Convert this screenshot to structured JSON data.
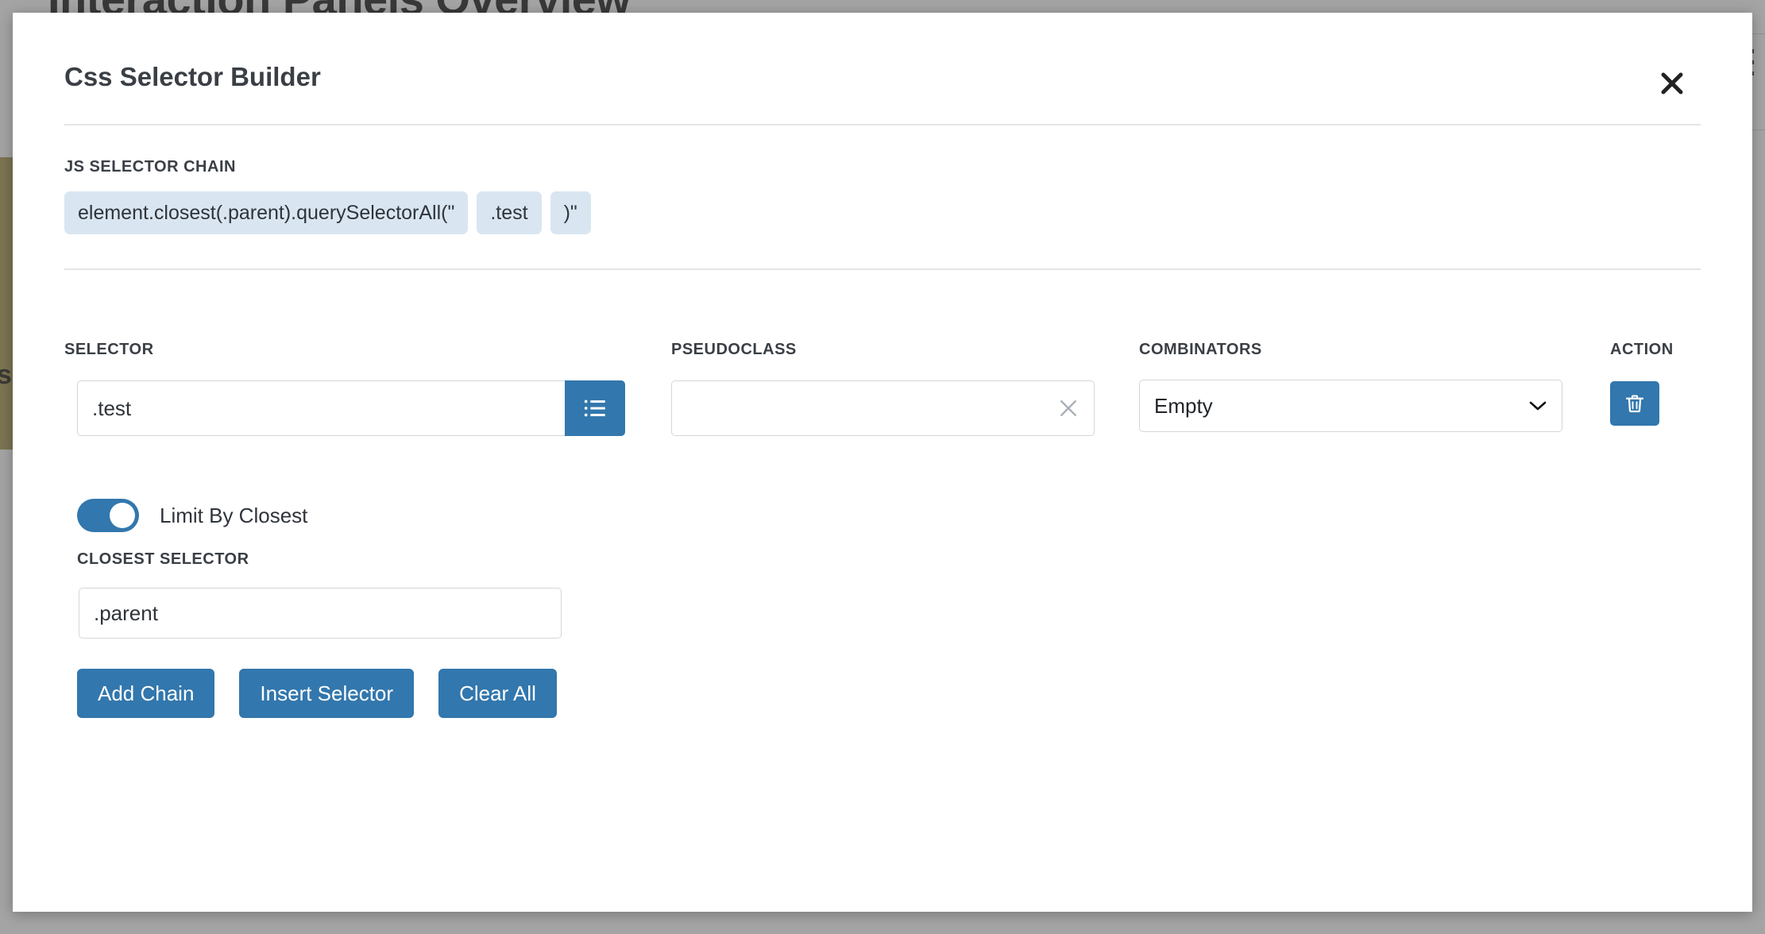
{
  "background": {
    "page_title": "Interaction Panels Overview",
    "side_panel_text": "ss",
    "menu_icon": "hamburger-icon"
  },
  "modal": {
    "title": "Css Selector Builder",
    "close_icon": "close-icon",
    "chain": {
      "label": "JS SELECTOR CHAIN",
      "chips": [
        "element.closest(.parent).querySelectorAll(\"",
        ".test",
        ")\""
      ]
    },
    "columns": {
      "selector": "SELECTOR",
      "pseudoclass": "PSEUDOCLASS",
      "combinators": "COMBINATORS",
      "action": "ACTION"
    },
    "row": {
      "selector_value": ".test",
      "selector_placeholder": "",
      "selector_list_icon": "list-icon",
      "pseudoclass_value": "",
      "pseudoclass_placeholder": "",
      "pseudoclass_clear_icon": "clear-x-icon",
      "combinator_selected": "Empty",
      "combinator_options": [
        "Empty"
      ],
      "combinator_chevron_icon": "chevron-down-icon",
      "delete_icon": "trash-icon"
    },
    "limit": {
      "toggle_label": "Limit By Closest",
      "toggle_on": true,
      "closest_label": "CLOSEST SELECTOR",
      "closest_value": ".parent",
      "closest_placeholder": ""
    },
    "buttons": {
      "add_chain": "Add Chain",
      "insert_selector": "Insert Selector",
      "clear_all": "Clear All"
    }
  },
  "colors": {
    "accent_blue": "#3277ad",
    "chip_bg": "#d9e6f2",
    "olive_panel": "#a5924a",
    "heading_text": "#3a3f45"
  }
}
